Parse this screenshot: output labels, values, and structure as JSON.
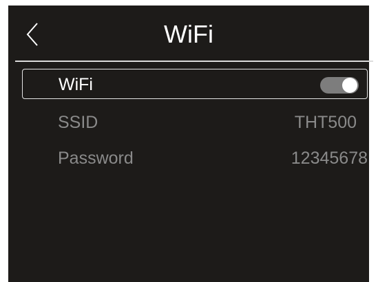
{
  "header": {
    "title": "WiFi",
    "back_icon": "chevron-left-icon"
  },
  "settings": [
    {
      "label": "WiFi",
      "type": "toggle",
      "on": true
    },
    {
      "label": "SSID",
      "value": "THT500"
    },
    {
      "label": "Password",
      "value": "12345678"
    }
  ],
  "colors": {
    "background": "#1d1b19",
    "text_active": "#ffffff",
    "text_muted": "#8a8a8a",
    "toggle_track": "#7d7d7d",
    "toggle_knob": "#ffffff"
  }
}
